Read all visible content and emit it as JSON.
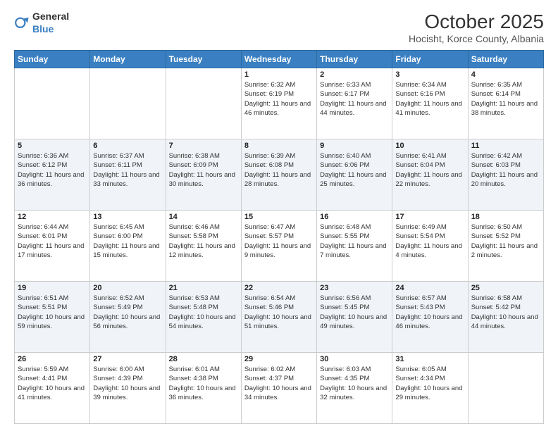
{
  "header": {
    "logo_general": "General",
    "logo_blue": "Blue",
    "month": "October 2025",
    "location": "Hocisht, Korce County, Albania"
  },
  "days_of_week": [
    "Sunday",
    "Monday",
    "Tuesday",
    "Wednesday",
    "Thursday",
    "Friday",
    "Saturday"
  ],
  "weeks": [
    [
      {
        "day": "",
        "info": ""
      },
      {
        "day": "",
        "info": ""
      },
      {
        "day": "",
        "info": ""
      },
      {
        "day": "1",
        "info": "Sunrise: 6:32 AM\nSunset: 6:19 PM\nDaylight: 11 hours and 46 minutes."
      },
      {
        "day": "2",
        "info": "Sunrise: 6:33 AM\nSunset: 6:17 PM\nDaylight: 11 hours and 44 minutes."
      },
      {
        "day": "3",
        "info": "Sunrise: 6:34 AM\nSunset: 6:16 PM\nDaylight: 11 hours and 41 minutes."
      },
      {
        "day": "4",
        "info": "Sunrise: 6:35 AM\nSunset: 6:14 PM\nDaylight: 11 hours and 38 minutes."
      }
    ],
    [
      {
        "day": "5",
        "info": "Sunrise: 6:36 AM\nSunset: 6:12 PM\nDaylight: 11 hours and 36 minutes."
      },
      {
        "day": "6",
        "info": "Sunrise: 6:37 AM\nSunset: 6:11 PM\nDaylight: 11 hours and 33 minutes."
      },
      {
        "day": "7",
        "info": "Sunrise: 6:38 AM\nSunset: 6:09 PM\nDaylight: 11 hours and 30 minutes."
      },
      {
        "day": "8",
        "info": "Sunrise: 6:39 AM\nSunset: 6:08 PM\nDaylight: 11 hours and 28 minutes."
      },
      {
        "day": "9",
        "info": "Sunrise: 6:40 AM\nSunset: 6:06 PM\nDaylight: 11 hours and 25 minutes."
      },
      {
        "day": "10",
        "info": "Sunrise: 6:41 AM\nSunset: 6:04 PM\nDaylight: 11 hours and 22 minutes."
      },
      {
        "day": "11",
        "info": "Sunrise: 6:42 AM\nSunset: 6:03 PM\nDaylight: 11 hours and 20 minutes."
      }
    ],
    [
      {
        "day": "12",
        "info": "Sunrise: 6:44 AM\nSunset: 6:01 PM\nDaylight: 11 hours and 17 minutes."
      },
      {
        "day": "13",
        "info": "Sunrise: 6:45 AM\nSunset: 6:00 PM\nDaylight: 11 hours and 15 minutes."
      },
      {
        "day": "14",
        "info": "Sunrise: 6:46 AM\nSunset: 5:58 PM\nDaylight: 11 hours and 12 minutes."
      },
      {
        "day": "15",
        "info": "Sunrise: 6:47 AM\nSunset: 5:57 PM\nDaylight: 11 hours and 9 minutes."
      },
      {
        "day": "16",
        "info": "Sunrise: 6:48 AM\nSunset: 5:55 PM\nDaylight: 11 hours and 7 minutes."
      },
      {
        "day": "17",
        "info": "Sunrise: 6:49 AM\nSunset: 5:54 PM\nDaylight: 11 hours and 4 minutes."
      },
      {
        "day": "18",
        "info": "Sunrise: 6:50 AM\nSunset: 5:52 PM\nDaylight: 11 hours and 2 minutes."
      }
    ],
    [
      {
        "day": "19",
        "info": "Sunrise: 6:51 AM\nSunset: 5:51 PM\nDaylight: 10 hours and 59 minutes."
      },
      {
        "day": "20",
        "info": "Sunrise: 6:52 AM\nSunset: 5:49 PM\nDaylight: 10 hours and 56 minutes."
      },
      {
        "day": "21",
        "info": "Sunrise: 6:53 AM\nSunset: 5:48 PM\nDaylight: 10 hours and 54 minutes."
      },
      {
        "day": "22",
        "info": "Sunrise: 6:54 AM\nSunset: 5:46 PM\nDaylight: 10 hours and 51 minutes."
      },
      {
        "day": "23",
        "info": "Sunrise: 6:56 AM\nSunset: 5:45 PM\nDaylight: 10 hours and 49 minutes."
      },
      {
        "day": "24",
        "info": "Sunrise: 6:57 AM\nSunset: 5:43 PM\nDaylight: 10 hours and 46 minutes."
      },
      {
        "day": "25",
        "info": "Sunrise: 6:58 AM\nSunset: 5:42 PM\nDaylight: 10 hours and 44 minutes."
      }
    ],
    [
      {
        "day": "26",
        "info": "Sunrise: 5:59 AM\nSunset: 4:41 PM\nDaylight: 10 hours and 41 minutes."
      },
      {
        "day": "27",
        "info": "Sunrise: 6:00 AM\nSunset: 4:39 PM\nDaylight: 10 hours and 39 minutes."
      },
      {
        "day": "28",
        "info": "Sunrise: 6:01 AM\nSunset: 4:38 PM\nDaylight: 10 hours and 36 minutes."
      },
      {
        "day": "29",
        "info": "Sunrise: 6:02 AM\nSunset: 4:37 PM\nDaylight: 10 hours and 34 minutes."
      },
      {
        "day": "30",
        "info": "Sunrise: 6:03 AM\nSunset: 4:35 PM\nDaylight: 10 hours and 32 minutes."
      },
      {
        "day": "31",
        "info": "Sunrise: 6:05 AM\nSunset: 4:34 PM\nDaylight: 10 hours and 29 minutes."
      },
      {
        "day": "",
        "info": ""
      }
    ]
  ]
}
